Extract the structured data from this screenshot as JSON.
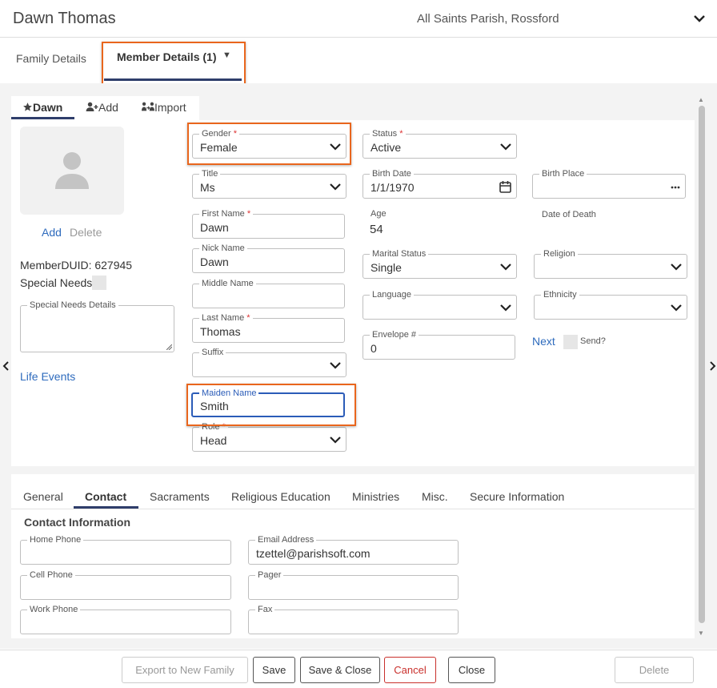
{
  "header": {
    "title": "Dawn Thomas",
    "parish": "All Saints Parish, Rossford"
  },
  "tabs": {
    "family": "Family Details",
    "member": "Member Details (1)",
    "member_caret": "▼"
  },
  "member_tabs": {
    "current": "Dawn",
    "add": "Add",
    "import": "Import"
  },
  "photo": {
    "add": "Add",
    "delete": "Delete"
  },
  "member": {
    "duid": "MemberDUID: 627945",
    "special_needs": "Special Needs",
    "special_needs_details": "Special Needs Details",
    "life_events": "Life Events"
  },
  "fields": {
    "gender": {
      "label": "Gender",
      "value": "Female"
    },
    "title": {
      "label": "Title",
      "value": "Ms"
    },
    "first_name": {
      "label": "First Name",
      "value": "Dawn"
    },
    "nick_name": {
      "label": "Nick Name",
      "value": "Dawn"
    },
    "middle_name": {
      "label": "Middle Name",
      "value": ""
    },
    "last_name": {
      "label": "Last Name",
      "value": "Thomas"
    },
    "suffix": {
      "label": "Suffix",
      "value": ""
    },
    "maiden_name": {
      "label": "Maiden Name",
      "value": "Smith"
    },
    "role": {
      "label": "Role",
      "value": "Head"
    },
    "status": {
      "label": "Status",
      "value": "Active"
    },
    "birth_date": {
      "label": "Birth Date",
      "value": "1/1/1970"
    },
    "age": {
      "label": "Age",
      "value": "54"
    },
    "marital_status": {
      "label": "Marital Status",
      "value": "Single"
    },
    "language": {
      "label": "Language",
      "value": ""
    },
    "envelope": {
      "label": "Envelope #",
      "value": "0"
    },
    "birth_place": {
      "label": "Birth Place",
      "value": ""
    },
    "date_of_death": {
      "label": "Date of Death"
    },
    "religion": {
      "label": "Religion",
      "value": ""
    },
    "ethnicity": {
      "label": "Ethnicity",
      "value": ""
    },
    "next": "Next",
    "send": "Send?"
  },
  "bottom_tabs": [
    "General",
    "Contact",
    "Sacraments",
    "Religious Education",
    "Ministries",
    "Misc.",
    "Secure Information"
  ],
  "contact": {
    "title": "Contact Information",
    "home_phone": {
      "label": "Home Phone",
      "value": ""
    },
    "cell_phone": {
      "label": "Cell Phone",
      "value": ""
    },
    "work_phone": {
      "label": "Work Phone",
      "value": ""
    },
    "email": {
      "label": "Email Address",
      "value": "tzettel@parishsoft.com"
    },
    "pager": {
      "label": "Pager",
      "value": ""
    },
    "fax": {
      "label": "Fax",
      "value": ""
    }
  },
  "footer": {
    "export": "Export to New Family",
    "save": "Save",
    "save_close": "Save & Close",
    "cancel": "Cancel",
    "close": "Close",
    "delete": "Delete"
  },
  "icons": {
    "header_toggle": "chevron-down-icon",
    "current_member": "star-icon",
    "add_member": "user-plus-icon",
    "import": "import-icon",
    "photo": "user-silhouette-icon",
    "select": "chevron-down-icon",
    "calendar": "calendar-icon",
    "more": "ellipsis-icon",
    "prev": "chevron-left-icon",
    "next": "chevron-right-icon"
  },
  "colors": {
    "accent": "#2f3e6b",
    "link": "#2e6bbd",
    "highlight": "#e9661d",
    "cancel": "#c9302c",
    "focus": "#2b5cb8"
  }
}
